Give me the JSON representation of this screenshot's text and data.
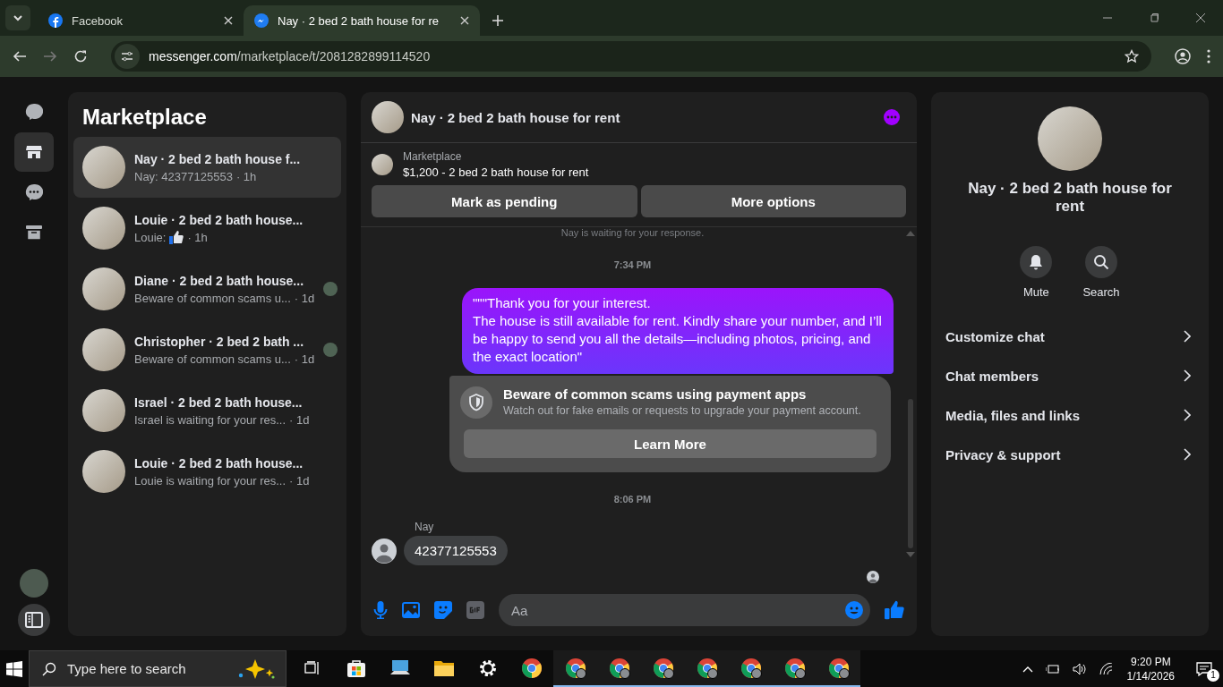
{
  "browser": {
    "tabs": [
      {
        "title": "Facebook",
        "kind": "facebook",
        "selected": false
      },
      {
        "title": "Nay · 2 bed 2 bath house for re",
        "kind": "messenger",
        "selected": true
      }
    ],
    "url_host": "messenger.com",
    "url_path": "/marketplace/t/2081282899114520"
  },
  "rail": {
    "items": [
      {
        "kind": "chats",
        "selected": false
      },
      {
        "kind": "marketplace",
        "selected": true
      },
      {
        "kind": "requests",
        "selected": false
      },
      {
        "kind": "archive",
        "selected": false
      }
    ]
  },
  "list": {
    "title": "Marketplace",
    "conversations": [
      {
        "name": "Nay · 2 bed 2 bath house f...",
        "preview": "Nay: 42377125553",
        "like": false,
        "time": "· 1h",
        "selected": true,
        "seen_avatar": false
      },
      {
        "name": "Louie · 2 bed 2 bath house...",
        "preview": "Louie:",
        "like": true,
        "time": "· 1h",
        "selected": false,
        "seen_avatar": false
      },
      {
        "name": "Diane · 2 bed 2 bath house...",
        "preview": "Beware of common scams u...",
        "like": false,
        "time": "· 1d",
        "selected": false,
        "seen_avatar": true
      },
      {
        "name": "Christopher · 2 bed 2 bath ...",
        "preview": "Beware of common scams u...",
        "like": false,
        "time": "· 1d",
        "selected": false,
        "seen_avatar": true
      },
      {
        "name": "Israel · 2 bed 2 bath house...",
        "preview": "Israel is waiting for your res...",
        "like": false,
        "time": "· 1d",
        "selected": false,
        "seen_avatar": false
      },
      {
        "name": "Louie · 2 bed 2 bath house...",
        "preview": "Louie is waiting for your res...",
        "like": false,
        "time": "· 1d",
        "selected": false,
        "seen_avatar": false
      }
    ]
  },
  "chat": {
    "title": "Nay · 2 bed 2 bath house for rent",
    "listing": {
      "label": "Marketplace",
      "title": "$1,200 - 2 bed 2 bath house for rent"
    },
    "buttons": [
      "Mark as pending",
      "More options"
    ],
    "messages": [
      {
        "kind": "notice",
        "text": "Nay is waiting for your response."
      },
      {
        "kind": "time",
        "text": "7:34 PM"
      },
      {
        "kind": "outgoing",
        "lines": [
          "\"\"\"Thank you for your interest.",
          "The house is still available for rent. Kindly share your number, and I’ll be happy to send you all the details—including photos, pricing, and the exact location\""
        ]
      },
      {
        "kind": "warning",
        "title": "Beware of common scams using payment apps",
        "text": "Watch out for fake emails or requests to upgrade your payment account.",
        "button": "Learn More"
      },
      {
        "kind": "time",
        "text": "8:06 PM"
      },
      {
        "kind": "incoming",
        "sender": "Nay",
        "text": "42377125553"
      }
    ],
    "composer": {
      "placeholder": "Aa"
    }
  },
  "details": {
    "name": "Nay · 2 bed 2 bath house for rent",
    "actions": [
      {
        "label": "Mute",
        "kind": "bell"
      },
      {
        "label": "Search",
        "kind": "search"
      }
    ],
    "menu": [
      "Customize chat",
      "Chat members",
      "Media, files and links",
      "Privacy & support"
    ]
  },
  "taskbar": {
    "search": {
      "placeholder": "Type here to search"
    },
    "apps": [
      {
        "kind": "taskview",
        "running": false
      },
      {
        "kind": "store",
        "running": false
      },
      {
        "kind": "computer",
        "running": false
      },
      {
        "kind": "folder",
        "running": false
      },
      {
        "kind": "settings",
        "running": false
      },
      {
        "kind": "chrome",
        "running": false
      },
      {
        "kind": "chrome-profile",
        "running": true
      },
      {
        "kind": "chrome-profile",
        "running": true
      },
      {
        "kind": "chrome-profile",
        "running": true
      },
      {
        "kind": "chrome-profile",
        "running": true
      },
      {
        "kind": "chrome-profile",
        "running": true
      },
      {
        "kind": "chrome-profile",
        "running": true
      },
      {
        "kind": "chrome-profile",
        "running": true
      }
    ],
    "time": "9:20 PM",
    "date": "1/14/2026",
    "notifications": "1"
  }
}
